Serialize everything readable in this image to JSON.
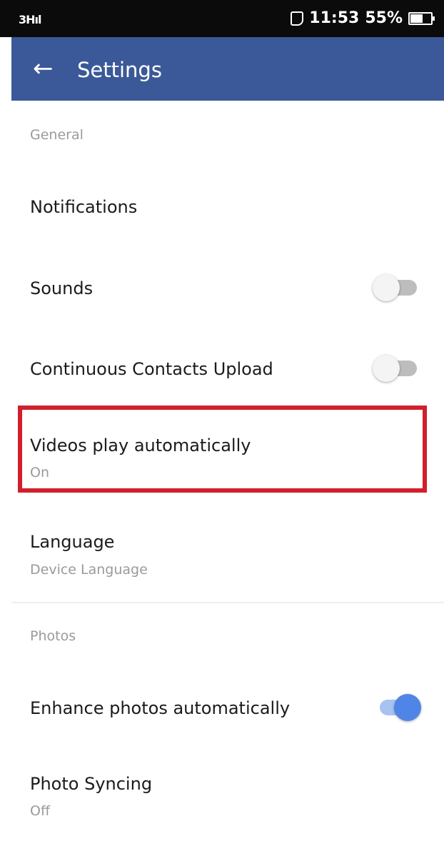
{
  "status_bar": {
    "signal": "3ᴴıl",
    "time": "11:53",
    "battery_percent": "55%",
    "icons": [
      "signal-icon",
      "phone-icon",
      "battery-icon"
    ]
  },
  "app_bar": {
    "back_icon": "arrow-left-icon",
    "title": "Settings",
    "color": "#3b5998"
  },
  "sections": [
    {
      "header": "General",
      "rows": [
        {
          "title": "Notifications"
        },
        {
          "title": "Sounds",
          "toggle": "off"
        },
        {
          "title": "Continuous Contacts Upload",
          "toggle": "off"
        },
        {
          "title": "Videos play automatically",
          "subtitle": "On",
          "highlighted": true
        },
        {
          "title": "Language",
          "subtitle": "Device Language"
        }
      ]
    },
    {
      "header": "Photos",
      "rows": [
        {
          "title": "Enhance photos automatically",
          "toggle": "on"
        },
        {
          "title": "Photo Syncing",
          "subtitle": "Off"
        }
      ]
    }
  ],
  "colors": {
    "highlight": "#d11f2b",
    "toggle_on": "#4f85e6"
  }
}
